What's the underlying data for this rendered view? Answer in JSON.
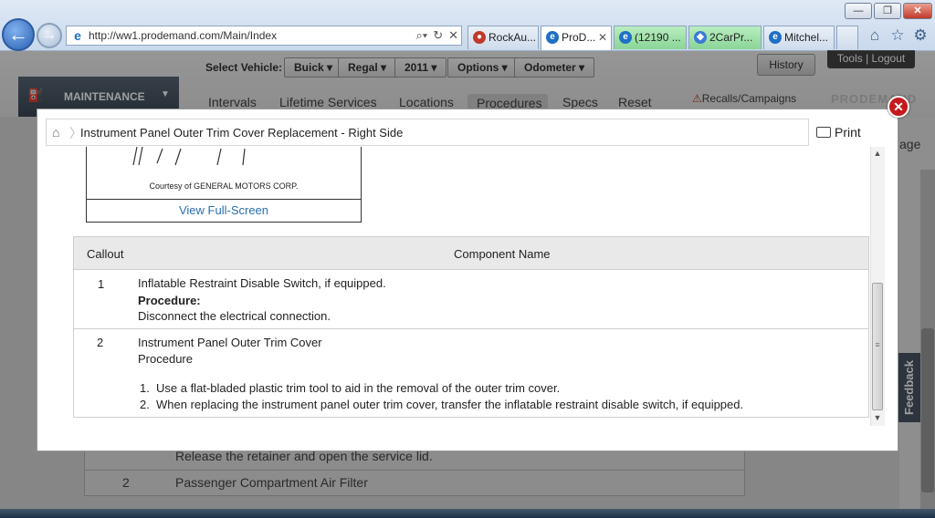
{
  "browser": {
    "url": "http://ww1.prodemand.com/Main/Index",
    "tabs": [
      {
        "label": "RockAu...",
        "icon": "rockauto-icon"
      },
      {
        "label": "ProD...",
        "icon": "ie-page-icon",
        "active": true
      },
      {
        "label": "(12190 ...",
        "icon": "ie-page-icon"
      },
      {
        "label": "2CarPr...",
        "icon": "forum-icon"
      },
      {
        "label": "Mitchel...",
        "icon": "ie-page-icon"
      }
    ],
    "window_controls": {
      "minimize": "—",
      "maximize": "❐",
      "close": "✕"
    }
  },
  "app": {
    "select_vehicle_label": "Select Vehicle:",
    "vehicle": {
      "make": "Buick ▾",
      "model": "Regal ▾",
      "year": "2011 ▾",
      "options": "Options ▾",
      "odometer": "Odometer ▾"
    },
    "history": "History",
    "tools_logout": "Tools | Logout",
    "module": "MAINTENANCE",
    "nav_tabs": [
      "Intervals",
      "Lifetime Services",
      "Locations",
      "Procedures",
      "Specs",
      "Reset"
    ],
    "recalls": "Recalls/Campaigns",
    "logo": "PRODEMAND",
    "right_partial": "age",
    "feedback": "Feedback",
    "background_rows": [
      {
        "callout": "",
        "text": "Release the retainer and open the service lid."
      },
      {
        "callout": "2",
        "text": "Passenger Compartment Air Filter"
      }
    ]
  },
  "modal": {
    "title": "Instrument Panel Outer Trim Cover Replacement - Right Side",
    "print": "Print",
    "figure": {
      "caption": "Courtesy of GENERAL MOTORS CORP.",
      "view_full_screen": "View Full-Screen"
    },
    "table": {
      "headers": [
        "Callout",
        "Component Name"
      ],
      "rows": [
        {
          "callout": "1",
          "name": "Inflatable Restraint Disable Switch, if equipped.",
          "procedure_label": "Procedure:",
          "procedure_text": "Disconnect the electrical connection."
        },
        {
          "callout": "2",
          "name": "Instrument Panel Outer Trim Cover",
          "procedure_label": "Procedure",
          "steps": [
            {
              "n": "1.",
              "text": "Use a flat-bladed plastic trim tool to aid in the removal of the outer trim cover."
            },
            {
              "n": "2.",
              "text": "When replacing the instrument panel outer trim cover, transfer the inflatable restraint disable switch, if equipped."
            }
          ]
        }
      ]
    }
  },
  "colors": {
    "accent_link": "#2a6fb0",
    "close_red": "#c7191c",
    "green_tab": "#8ad596"
  }
}
